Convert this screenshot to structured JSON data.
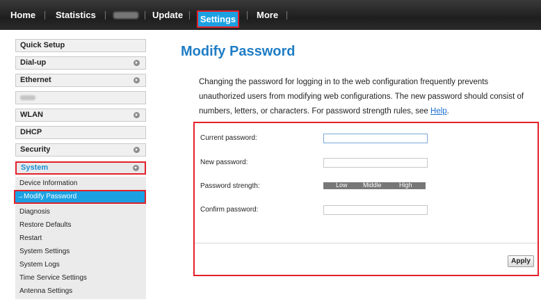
{
  "nav": {
    "home": "Home",
    "statistics": "Statistics",
    "update": "Update",
    "settings": "Settings",
    "more": "More"
  },
  "sidebar": {
    "quick_setup": "Quick Setup",
    "dialup": "Dial-up",
    "ethernet": "Ethernet",
    "wlan": "WLAN",
    "dhcp": "DHCP",
    "security": "Security",
    "system": "System",
    "sub_items": [
      "Device Information",
      "→Modify Password",
      "Diagnosis",
      "Restore Defaults",
      "Restart",
      "System Settings",
      "System Logs",
      "Time Service Settings",
      "Antenna Settings"
    ]
  },
  "main": {
    "title": "Modify Password",
    "description": "Changing the password for logging in to the web configuration frequently prevents unauthorized users from modifying web configurations. The new password should consist of numbers, letters, or characters. For password strength rules, see",
    "help_link": "Help",
    "description_end": "."
  },
  "form": {
    "current_password_label": "Current password:",
    "new_password_label": "New password:",
    "strength_label": "Password strength:",
    "strength_low": "Low",
    "strength_middle": "Middle",
    "strength_high": "High",
    "confirm_password_label": "Confirm password:",
    "current_password_value": "",
    "new_password_value": "",
    "confirm_password_value": "",
    "apply_label": "Apply"
  },
  "colors": {
    "accent_blue": "#1ba1e2",
    "highlight_red": "#e2202a",
    "title_blue": "#1f7dc5"
  },
  "icons": {
    "sidebar_expand": "chevron-right-icon",
    "sidebar_collapse": "chevron-down-icon"
  }
}
